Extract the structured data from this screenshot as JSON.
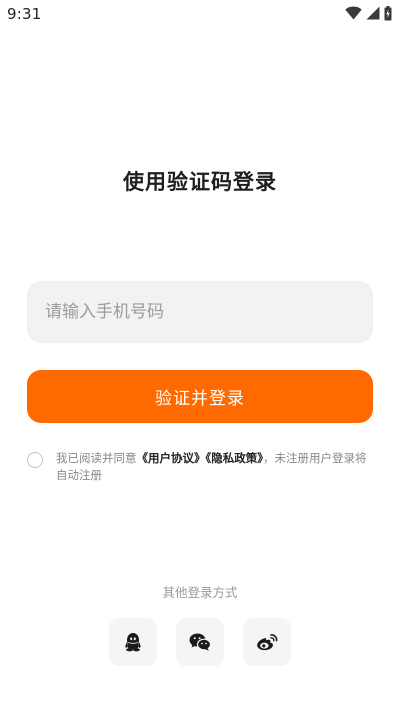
{
  "status_bar": {
    "time": "9:31",
    "icons": [
      "wifi-icon",
      "signal-icon",
      "battery-charging-icon"
    ]
  },
  "page": {
    "title": "使用验证码登录"
  },
  "form": {
    "phone_placeholder": "请输入手机号码",
    "phone_value": "",
    "submit_label": "验证并登录"
  },
  "agreement": {
    "checked": false,
    "prefix": "我已阅读并同意",
    "user_agreement": "《用户协议》",
    "privacy_policy": "《隐私政策》",
    "suffix": "，未注册用户登录将自动注册"
  },
  "other_login": {
    "title": "其他登录方式",
    "methods": [
      {
        "name": "qq",
        "icon": "qq-icon"
      },
      {
        "name": "wechat",
        "icon": "wechat-icon"
      },
      {
        "name": "weibo",
        "icon": "weibo-icon"
      }
    ]
  },
  "colors": {
    "accent": "#ff6a00",
    "input_bg": "#f2f2f2",
    "social_bg": "#f5f5f5",
    "title_text": "#1f1f1f",
    "muted_text": "#888888"
  }
}
